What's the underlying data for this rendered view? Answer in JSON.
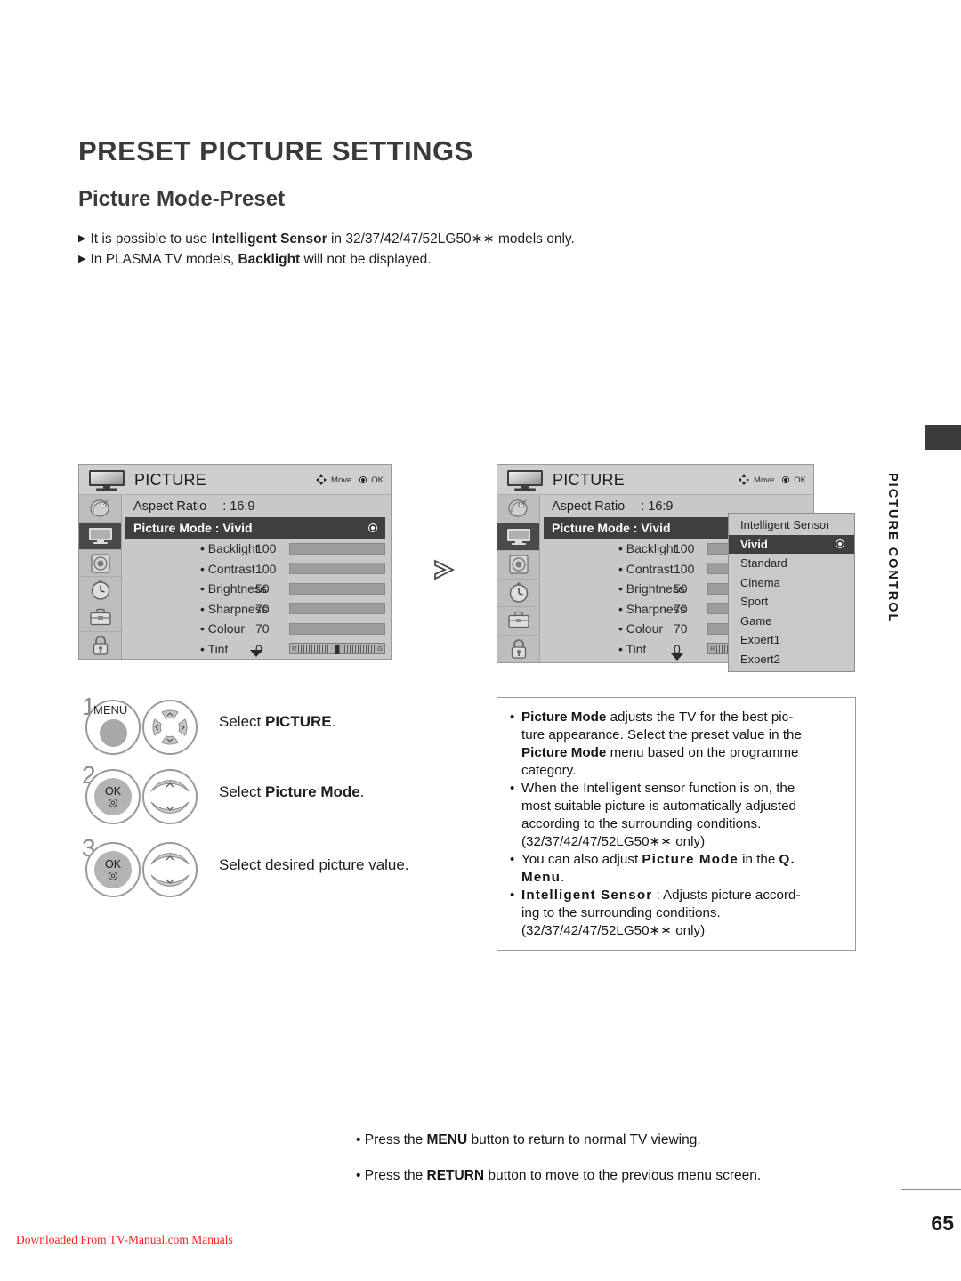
{
  "page": {
    "title": "PRESET PICTURE SETTINGS",
    "subtitle": "Picture Mode-Preset",
    "notes": [
      {
        "pre": "It is possible to use ",
        "bold": "Intelligent Sensor",
        "post": " in 32/37/42/47/52LG50∗∗ models only."
      },
      {
        "pre": "In PLASMA TV models, ",
        "bold": "Backlight",
        "post": " will not be displayed."
      }
    ],
    "page_number": "65",
    "download_note": "Downloaded From TV-Manual.com Manuals"
  },
  "side_tab": {
    "label": "PICTURE CONTROL"
  },
  "osd": {
    "title": "PICTURE",
    "hint_move": "Move",
    "hint_ok": "OK",
    "aspect_label": "Aspect Ratio",
    "aspect_value": ": 16:9",
    "picture_mode_row": "Picture Mode : Vivid",
    "rail_icons": [
      "satellite-dish-icon",
      "tv-picture-icon",
      "speaker-audio-icon",
      "clock-time-icon",
      "toolbox-option-icon",
      "padlock-lock-icon"
    ],
    "items": [
      {
        "label": "• Backlight",
        "value": "100",
        "percent": 100,
        "type": "bar"
      },
      {
        "label": "• Contrast",
        "value": "100",
        "percent": 100,
        "type": "bar"
      },
      {
        "label": "• Brightness",
        "value": "50",
        "percent": 50,
        "type": "bar"
      },
      {
        "label": "• Sharpness",
        "value": "70",
        "percent": 70,
        "type": "bar"
      },
      {
        "label": "• Colour",
        "value": "70",
        "percent": 70,
        "type": "bar"
      },
      {
        "label": "• Tint",
        "value": "0",
        "percent": 50,
        "type": "tint",
        "left_mark": "R",
        "right_mark": "G"
      }
    ]
  },
  "dropdown": {
    "options": [
      "Intelligent Sensor",
      "Vivid",
      "Standard",
      "Cinema",
      "Sport",
      "Game",
      "Expert1",
      "Expert2"
    ],
    "selected": "Vivid"
  },
  "steps": [
    {
      "num": "1",
      "button": "MENU",
      "pad": "4-way",
      "text_pre": "Select ",
      "text_bold": "PICTURE",
      "text_post": "."
    },
    {
      "num": "2",
      "button": "OK",
      "pad": "up-down",
      "text_pre": "Select ",
      "text_bold": "Picture Mode",
      "text_post": "."
    },
    {
      "num": "3",
      "button": "OK",
      "pad": "up-down",
      "text_pre": "Select desired picture value.",
      "text_bold": "",
      "text_post": ""
    }
  ],
  "info_box": {
    "lines": [
      {
        "segs": [
          {
            "t": "Picture Mode",
            "b": true
          },
          {
            "t": " adjusts the TV for the best pic-",
            "b": false
          }
        ]
      },
      {
        "segs": [
          {
            "t": "ture appearance. Select the preset value in the",
            "b": false
          }
        ],
        "indent": true
      },
      {
        "segs": [
          {
            "t": "Picture Mode",
            "b": true
          },
          {
            "t": " menu based on the programme",
            "b": false
          }
        ],
        "indent": true
      },
      {
        "segs": [
          {
            "t": "category.",
            "b": false
          }
        ],
        "indent": true
      },
      {
        "segs": [
          {
            "t": "When the Intelligent sensor function is on, the",
            "b": false
          }
        ],
        "bullet": true
      },
      {
        "segs": [
          {
            "t": "most suitable picture is automatically adjusted",
            "b": false
          }
        ],
        "indent": true
      },
      {
        "segs": [
          {
            "t": "according to the surrounding conditions.",
            "b": false
          }
        ],
        "indent": true
      },
      {
        "segs": [
          {
            "t": "(32/37/42/47/52LG50∗∗ only)",
            "b": false
          }
        ],
        "indent": true
      },
      {
        "segs": [
          {
            "t": "You can also adjust ",
            "b": false
          },
          {
            "t": "Picture Mode",
            "b": true,
            "wide": true
          },
          {
            "t": " in the ",
            "b": false
          },
          {
            "t": "Q.",
            "b": true,
            "wide": true
          }
        ],
        "bullet": true
      },
      {
        "segs": [
          {
            "t": "Menu",
            "b": true,
            "wide": true
          },
          {
            "t": ".",
            "b": false
          }
        ],
        "indent": true
      },
      {
        "segs": [
          {
            "t": "Intelligent Sensor",
            "b": true,
            "wide": true
          },
          {
            "t": " : Adjusts picture accord-",
            "b": false
          }
        ],
        "bullet": true
      },
      {
        "segs": [
          {
            "t": "ing to the surrounding conditions.",
            "b": false
          }
        ],
        "indent": true
      },
      {
        "segs": [
          {
            "t": "(32/37/42/47/52LG50∗∗ only)",
            "b": false
          }
        ],
        "indent": true
      }
    ]
  },
  "footer": {
    "line1_pre": "Press the ",
    "line1_bold": "MENU",
    "line1_post": " button to return to normal TV viewing.",
    "line2_pre": "Press the ",
    "line2_bold": "RETURN",
    "line2_post": " button to move to the previous menu screen."
  }
}
